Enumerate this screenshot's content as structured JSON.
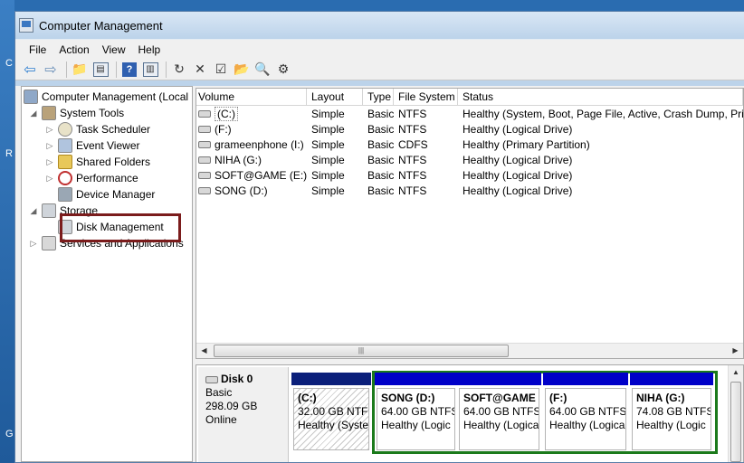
{
  "window": {
    "title": "Computer Management"
  },
  "menu": [
    "File",
    "Action",
    "View",
    "Help"
  ],
  "desktop_letters": [
    "C",
    "R",
    "G"
  ],
  "tree": {
    "root": "Computer Management (Local",
    "system_tools": "System Tools",
    "task_scheduler": "Task Scheduler",
    "event_viewer": "Event Viewer",
    "shared_folders": "Shared Folders",
    "performance": "Performance",
    "device_manager": "Device Manager",
    "storage": "Storage",
    "disk_management": "Disk Management",
    "services": "Services and Applications"
  },
  "volumes": {
    "headers": [
      "Volume",
      "Layout",
      "Type",
      "File System",
      "Status"
    ],
    "rows": [
      {
        "volume": "(C:)",
        "layout": "Simple",
        "type": "Basic",
        "fs": "NTFS",
        "status": "Healthy (System, Boot, Page File, Active, Crash Dump, Prim"
      },
      {
        "volume": "(F:)",
        "layout": "Simple",
        "type": "Basic",
        "fs": "NTFS",
        "status": "Healthy (Logical Drive)"
      },
      {
        "volume": "grameenphone (I:)",
        "layout": "Simple",
        "type": "Basic",
        "fs": "CDFS",
        "status": "Healthy (Primary Partition)"
      },
      {
        "volume": "NIHA (G:)",
        "layout": "Simple",
        "type": "Basic",
        "fs": "NTFS",
        "status": "Healthy (Logical Drive)"
      },
      {
        "volume": "SOFT@GAME (E:)",
        "layout": "Simple",
        "type": "Basic",
        "fs": "NTFS",
        "status": "Healthy (Logical Drive)"
      },
      {
        "volume": "SONG (D:)",
        "layout": "Simple",
        "type": "Basic",
        "fs": "NTFS",
        "status": "Healthy (Logical Drive)"
      }
    ]
  },
  "disk": {
    "name": "Disk 0",
    "type": "Basic",
    "size": "298.09 GB",
    "state": "Online",
    "partitions": [
      {
        "title": "(C:)",
        "size": "32.00 GB NTFS",
        "status": "Healthy (Syste"
      },
      {
        "title": "SONG  (D:)",
        "size": "64.00 GB NTFS",
        "status": "Healthy (Logic"
      },
      {
        "title": "SOFT@GAME",
        "size": "64.00 GB NTFS",
        "status": "Healthy (Logica"
      },
      {
        "title": "(F:)",
        "size": "64.00 GB NTFS",
        "status": "Healthy (Logica"
      },
      {
        "title": "NIHA  (G:)",
        "size": "74.08 GB NTFS",
        "status": "Healthy (Logic"
      }
    ]
  },
  "colors": {
    "primary_partition": "#0b1f7a",
    "logical_drive": "#0000c8",
    "extended_outline": "#1b7a1b",
    "selection_outline": "#7b1c1c"
  }
}
